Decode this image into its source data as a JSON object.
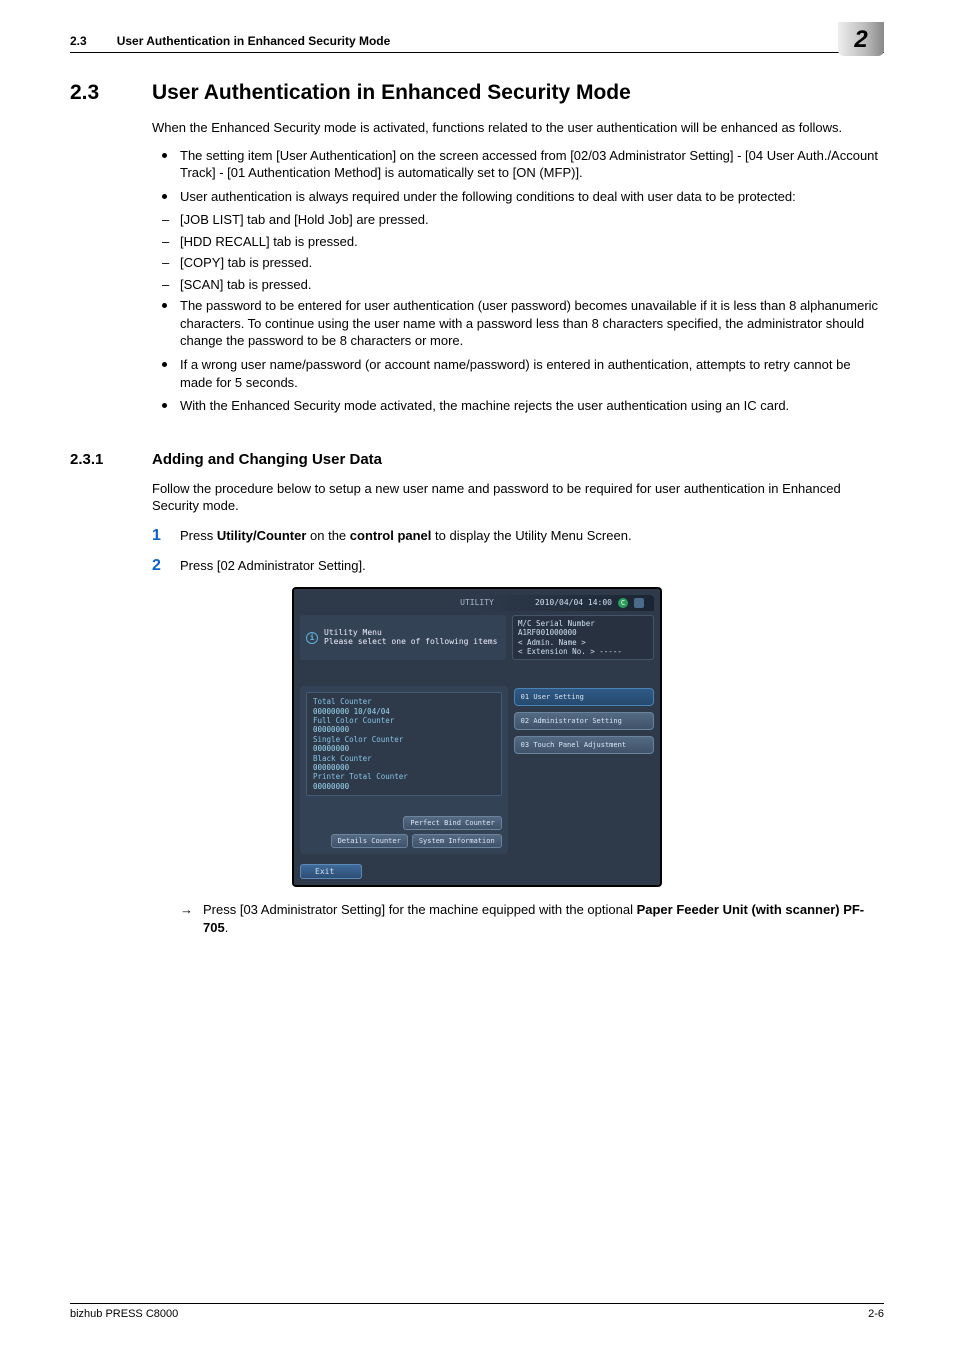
{
  "header": {
    "section_num": "2.3",
    "section_title": "User Authentication in Enhanced Security Mode",
    "chapter_badge": "2"
  },
  "section": {
    "num": "2.3",
    "title": "User Authentication in Enhanced Security Mode",
    "intro": "When the Enhanced Security mode is activated, functions related to the user authentication will be enhanced as follows.",
    "bullets": {
      "b1": "The setting item [User Authentication] on the screen accessed from [02/03 Administrator Setting] - [04 User Auth./Account Track] - [01 Authentication Method] is automatically set to [ON (MFP)].",
      "b2": "User authentication is always required under the following conditions to deal with user data to be protected:",
      "d1": "[JOB LIST] tab and [Hold Job] are pressed.",
      "d2": "[HDD RECALL] tab is pressed.",
      "d3": "[COPY] tab is pressed.",
      "d4": "[SCAN] tab is pressed.",
      "b3": "The password to be entered for user authentication (user password) becomes unavailable if it is less than 8 alphanumeric characters. To continue using the user name with a password less than 8 characters specified, the administrator should change the password to be 8 characters or more.",
      "b4": "If a wrong user name/password (or account name/password) is entered in authentication, attempts to retry cannot be made for 5 seconds.",
      "b5": "With the Enhanced Security mode activated, the machine rejects the user authentication using an IC card."
    }
  },
  "subsection": {
    "num": "2.3.1",
    "title": "Adding and Changing User Data",
    "intro": "Follow the procedure below to setup a new user name and password to be required for user authentication in Enhanced Security mode.",
    "steps": {
      "n1": "1",
      "t1_before": "Press ",
      "t1_b1": "Utility/Counter",
      "t1_mid": " on the ",
      "t1_b2": "control panel",
      "t1_after": " to display the Utility Menu Screen.",
      "n2": "2",
      "t2": "Press [02 Administrator Setting]."
    },
    "arrow_before": "Press [03 Administrator Setting] for the machine equipped with the optional ",
    "arrow_b": "Paper Feeder Unit (with scanner) PF-705",
    "arrow_after": "."
  },
  "screenshot": {
    "topbar_title": "UTILITY",
    "datetime": "2010/04/04 14:00",
    "status_icon": "C",
    "serial": "M/C Serial Number  A1RF001000000",
    "admin_name": "< Admin. Name >",
    "extension": "< Extension No. >  -----",
    "umenu_line1": "Utility Menu",
    "umenu_line2": "Please select one of following items",
    "counters": {
      "total_label": "Total Counter",
      "total_val": "00000000   10/04/04",
      "full_label": "Full Color Counter",
      "full_val": "00000000",
      "single_label": "Single Color Counter",
      "single_val": "00000000",
      "black_label": "Black Counter",
      "black_val": "00000000",
      "printer_label": "Printer Total Counter",
      "printer_val": "00000000"
    },
    "left_btns": {
      "perfect": "Perfect Bind Counter",
      "details": "Details Counter",
      "sysinfo": "System Information"
    },
    "right_btns": {
      "b1": "01 User Setting",
      "b2": "02 Administrator Setting",
      "b3": "03 Touch Panel Adjustment"
    },
    "exit": "Exit"
  },
  "footer": {
    "left": "bizhub PRESS C8000",
    "right": "2-6"
  }
}
